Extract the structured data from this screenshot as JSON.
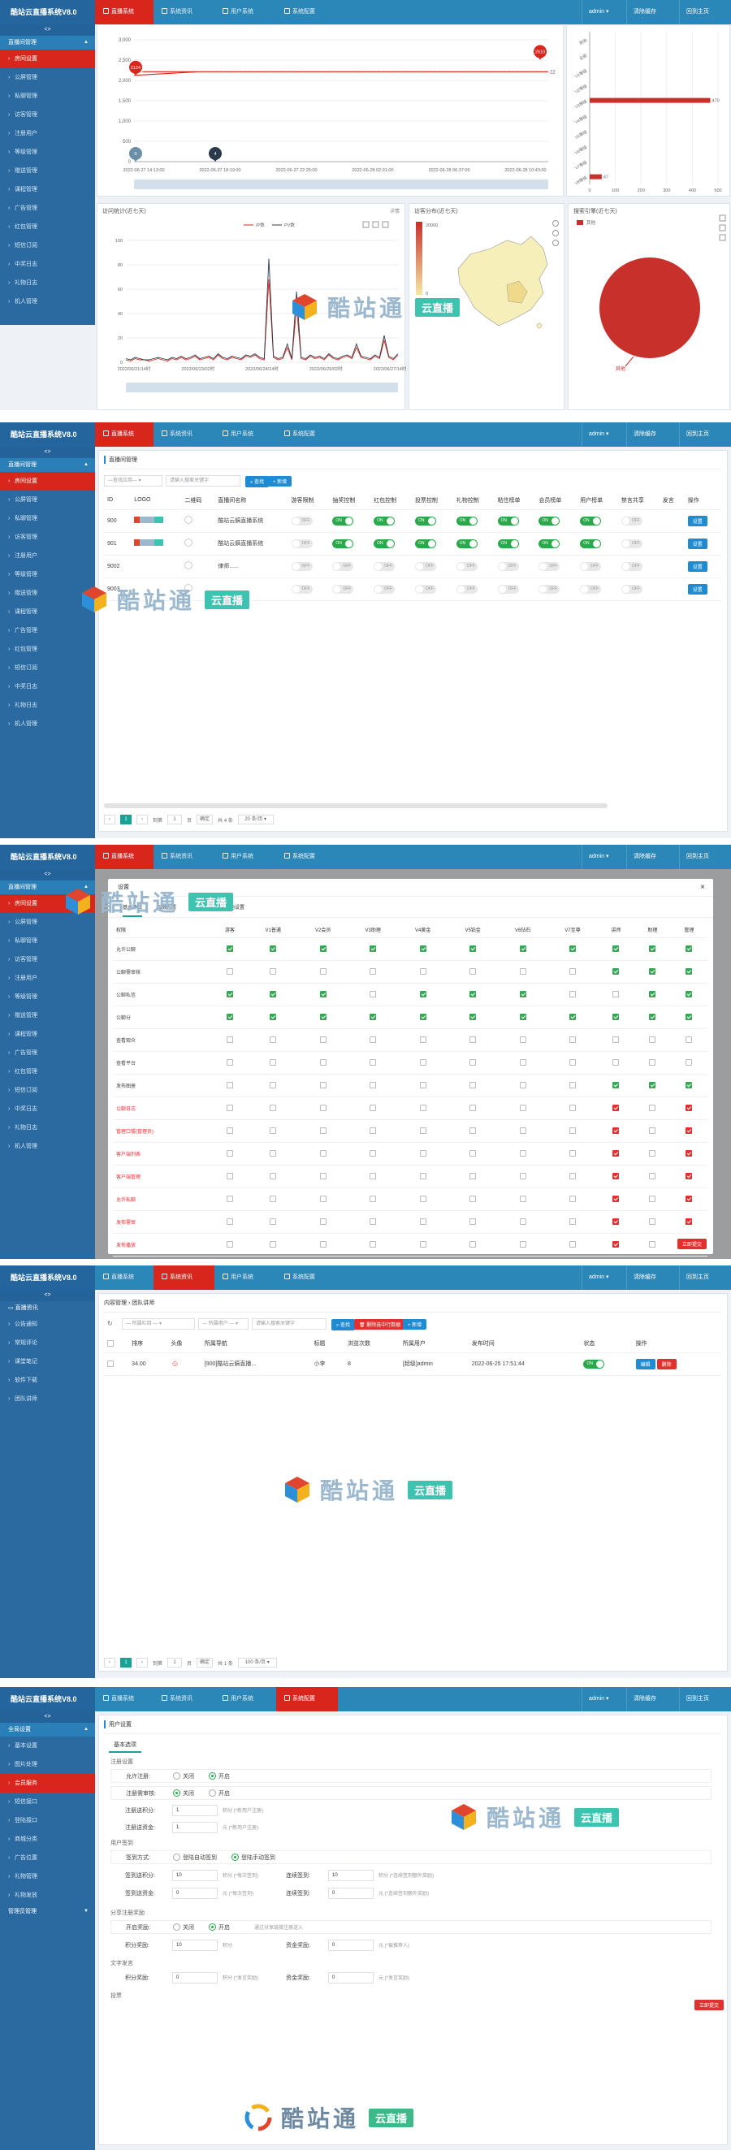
{
  "app": {
    "brand": "酷站云直播系统V8.0",
    "nav": [
      "直播系统",
      "系统资讯",
      "用户系统",
      "系统配置"
    ],
    "user": "admin",
    "clear_cache": "清除缓存",
    "home": "回到主页",
    "collapse": "<>"
  },
  "watermark": {
    "text": "酷站通",
    "badge": "云直播"
  },
  "s1": {
    "chart_data": [
      {
        "type": "line",
        "x": [
          "2022-06-27 14:13:00",
          "2022-06-27 18:19:00",
          "2022-06-27 22:25:00",
          "2022-06-28 02:31:00",
          "2022-06-28 06:37:00",
          "2022-06-28 10:43:00"
        ],
        "ylim": [
          0,
          3000
        ],
        "yticks": [
          "0",
          "500",
          "1,000",
          "1,500",
          "2,000",
          "2,500",
          "3,000"
        ],
        "series": [
          {
            "values": [
              2214,
              2214,
              2214,
              2214,
              2214,
              2214
            ]
          }
        ],
        "pins": [
          "2124",
          "2510",
          "0",
          "4"
        ],
        "end_label": "22"
      },
      {
        "type": "bar",
        "orientation": "horizontal",
        "categories": [
          "其他",
          "全部",
          "V1等级",
          "V2等级",
          "V3等级",
          "V4等级",
          "V5等级",
          "V6等级",
          "V7等级",
          "V8等级"
        ],
        "values": [
          0,
          0,
          0,
          0,
          470,
          0,
          0,
          0,
          0,
          47
        ],
        "bar_labels": [
          "470",
          "47"
        ],
        "xlim": [
          0,
          500
        ],
        "xticks": [
          "0",
          "100",
          "200",
          "300",
          "400",
          "500"
        ]
      },
      {
        "type": "line",
        "title": "访问统计(近七天)",
        "legend": [
          "IP数",
          "PV数"
        ],
        "ylim": [
          0,
          100
        ],
        "yticks": [
          "0",
          "20",
          "40",
          "60",
          "80",
          "100"
        ],
        "x": [
          "2022/06/21/14时",
          "2022/06/23/02时",
          "2022/06/24/14时",
          "2022/06/26/02时",
          "2022/06/27/14时"
        ],
        "series": [
          {
            "name": "IP数",
            "values": [
              2,
              1,
              3,
              2,
              2,
              1,
              2,
              3,
              2,
              1,
              3,
              2,
              4,
              2,
              3,
              5,
              2,
              3,
              4,
              2,
              6,
              3,
              2,
              4,
              3,
              2,
              5,
              4,
              6,
              3,
              2,
              68,
              4,
              2,
              3,
              12,
              2,
              45,
              3,
              2,
              5,
              3,
              4,
              2,
              6,
              3,
              2,
              4,
              5,
              3,
              12,
              4,
              3,
              2,
              5,
              3,
              18,
              4,
              2,
              6
            ]
          },
          {
            "name": "PV数",
            "values": [
              3,
              2,
              4,
              3,
              2,
              2,
              3,
              4,
              3,
              2,
              4,
              3,
              5,
              3,
              4,
              6,
              3,
              4,
              5,
              3,
              7,
              4,
              3,
              5,
              4,
              3,
              6,
              5,
              7,
              4,
              3,
              85,
              5,
              3,
              4,
              15,
              3,
              58,
              4,
              3,
              6,
              4,
              5,
              3,
              7,
              4,
              3,
              5,
              6,
              4,
              15,
              5,
              4,
              3,
              6,
              4,
              22,
              5,
              3,
              7
            ]
          }
        ]
      },
      {
        "type": "map",
        "title": "访客分布(近七天)",
        "scale_max": "20000",
        "scale_min": "0"
      },
      {
        "type": "pie",
        "title": "搜索引擎(近七天)",
        "legend": [
          "其他"
        ],
        "values": [
          100
        ],
        "label": "其他"
      }
    ],
    "detail": "详情"
  },
  "s2": {
    "sidebar_group": "直播间管理",
    "sidebar": [
      "房间设置",
      "公屏管理",
      "私聊管理",
      "访客管理",
      "注册用户",
      "等级管理",
      "赠送管理",
      "课程管理",
      "广告管理",
      "红包管理",
      "短信订阅",
      "中奖日志",
      "礼物日志",
      "机人管理"
    ],
    "page_title": "直播间管理",
    "select": "—查找应用—",
    "search_placeholder": "请输入搜索关键字",
    "search_btn": "查找",
    "add_btn": "+ 新增",
    "headers": [
      "ID",
      "LOGO",
      "二维码",
      "直播间名称",
      "游客限制",
      "抽奖控制",
      "红包控制",
      "投票控制",
      "礼物控制",
      "粘住榜单",
      "会员榜单",
      "用户榜单",
      "禁言共享",
      "发言",
      "操作"
    ],
    "rows": [
      {
        "id": "900",
        "name": "酷站云鎬直播系统",
        "toggles": [
          "OFF",
          "ON",
          "ON",
          "ON",
          "ON",
          "ON",
          "ON",
          "ON",
          "OFF"
        ],
        "op": "设置"
      },
      {
        "id": "901",
        "name": "酷站云鎬直播系统",
        "toggles": [
          "OFF",
          "ON",
          "ON",
          "ON",
          "ON",
          "ON",
          "ON",
          "ON",
          "OFF"
        ],
        "op": "设置"
      },
      {
        "id": "9002",
        "name": "律师......",
        "toggles": [
          "OFF",
          "OFF",
          "OFF",
          "OFF",
          "OFF",
          "OFF",
          "OFF",
          "OFF",
          "OFF"
        ],
        "op": "设置"
      },
      {
        "id": "9003",
        "name": "",
        "toggles": [
          "OFF",
          "OFF",
          "OFF",
          "OFF",
          "OFF",
          "OFF",
          "OFF",
          "OFF",
          "OFF"
        ],
        "op": "设置"
      }
    ],
    "pager": {
      "prev": "到第",
      "page": "1",
      "unit": "页",
      "confirm": "确定",
      "total": "共 4 条",
      "size": "20 条/页"
    }
  },
  "s3": {
    "dialog_title": "设置",
    "tabs": [
      "基本体验",
      "权限设置",
      "客服设置",
      "其他设置"
    ],
    "headers": [
      "权限",
      "游客",
      "V1普通",
      "V2会员",
      "V3助理",
      "V4黄金",
      "V5铂金",
      "V6钻石",
      "V7至尊",
      "讲师",
      "助理",
      "管理"
    ],
    "rows": [
      {
        "label": "允许公聊",
        "red": false,
        "cells": "ggggggggggg"
      },
      {
        "label": "公聊需审核",
        "red": false,
        "cells": "--------ggg"
      },
      {
        "label": "公聊私信",
        "red": false,
        "cells": "ggg-ggg--gg"
      },
      {
        "label": "公聊分",
        "red": false,
        "cells": "ggggggggggg"
      },
      {
        "label": "查看观众",
        "red": false,
        "cells": "-----------"
      },
      {
        "label": "查看平台",
        "red": false,
        "cells": "-----------"
      },
      {
        "label": "发布图册",
        "red": false,
        "cells": "--------ggg"
      },
      {
        "label": "公聊日志",
        "red": true,
        "cells": "--------r-r"
      },
      {
        "label": "管理口拔(管理员)",
        "red": true,
        "cells": "--------r-r"
      },
      {
        "label": "客户端列表",
        "red": true,
        "cells": "--------r-r"
      },
      {
        "label": "客户端管理",
        "red": true,
        "cells": "--------r-r"
      },
      {
        "label": "允许私聊",
        "red": true,
        "cells": "--------r-r"
      },
      {
        "label": "发布需审",
        "red": true,
        "cells": "--------r-r"
      },
      {
        "label": "发布播放",
        "red": true,
        "cells": "--------r-r"
      },
      {
        "label": "发布资讯",
        "red": true,
        "cells": "--------r-r"
      }
    ],
    "submit": "立即提交"
  },
  "s4": {
    "sidebar_group": "直播资讯",
    "sidebar": [
      "公告通知",
      "常规评论",
      "课堂笔记",
      "软件下载",
      "团队讲师"
    ],
    "breadcrumb": "内容管理 › 团队讲师",
    "select1": "— 所属栏目 —",
    "select2": "— 所属用户 —",
    "search_placeholder": "请输入搜索关键字",
    "search_btn": "查找",
    "batch_btn": "删除选中行数据",
    "add_btn": "+ 新增",
    "headers": [
      "排序",
      "头像",
      "所属导航",
      "标题",
      "浏览次数",
      "所属用户",
      "发布时间",
      "状态",
      "操作"
    ],
    "row": {
      "sort": "34.00",
      "nav": "[900]酷站云鎬直播...",
      "title": "小李",
      "views": "8",
      "user": "[超级]admin",
      "time": "2022-06-25 17:51:44",
      "status": "ON",
      "edit": "编辑",
      "del": "删除"
    },
    "pager": {
      "prev": "到第",
      "page": "1",
      "unit": "页",
      "confirm": "确定",
      "total": "共 1 条",
      "size": "100 条/页"
    }
  },
  "s5": {
    "sidebar_group": "全局设置",
    "sidebar": [
      "基本设置",
      "图片处理",
      "会员服务",
      "短信接口",
      "登陆接口",
      "商城分类",
      "广告位置",
      "礼物管理",
      "礼物发放"
    ],
    "sidebar_group2": "管理员管理",
    "page_title": "用户设置",
    "section": "基本选项",
    "reg_title": "注册设置",
    "allow_reg": "允许注册:",
    "reg_audit": "注册需审核:",
    "off": "关闭",
    "on": "开启",
    "reg_points": "注册送积分:",
    "reg_points_val": "1",
    "reg_points_hint": "积分  (*新用户注册)",
    "reg_money": "注册送资金:",
    "reg_money_val": "1",
    "reg_money_hint": "元  (*新用户注册)",
    "sign_title": "用户签到",
    "sign_mode": "签到方式:",
    "sign_mode1": "登陆自动签到",
    "sign_mode2": "登陆手动签到",
    "sign_points": "签到送积分:",
    "sign_points_val": "10",
    "sign_points_hint": "积分  (*每次签到)",
    "cont_points": "连续签到:",
    "cont_points_val": "10",
    "cont_points_hint": "积分 (*连续签到额外奖励)",
    "sign_money": "签到送资金:",
    "sign_money_val": "0",
    "sign_money_hint": "元  (*每次签到)",
    "cont_money": "连续签到:",
    "cont_money_val": "0",
    "cont_money_hint": "元 (*连续签到额外奖励)",
    "share_title": "分享注册奖励",
    "share_open": "开启奖励:",
    "share_hint": "通过分享链接注册送入",
    "share_points": "积分奖励:",
    "share_points_val": "10",
    "share_points_hint": "积分",
    "share_money": "资金奖励:",
    "share_money_val": "0",
    "share_money_hint": "元  (*被推荐人)",
    "post_title": "文字发言",
    "post_points": "积分奖励:",
    "post_points_val": "0",
    "post_points_hint": "积分  (*发言奖励)",
    "post_money": "资金奖励:",
    "post_money_val": "0",
    "post_money_hint": "元  (*发言奖励)",
    "vote_title": "投票",
    "submit": "立即提交"
  }
}
